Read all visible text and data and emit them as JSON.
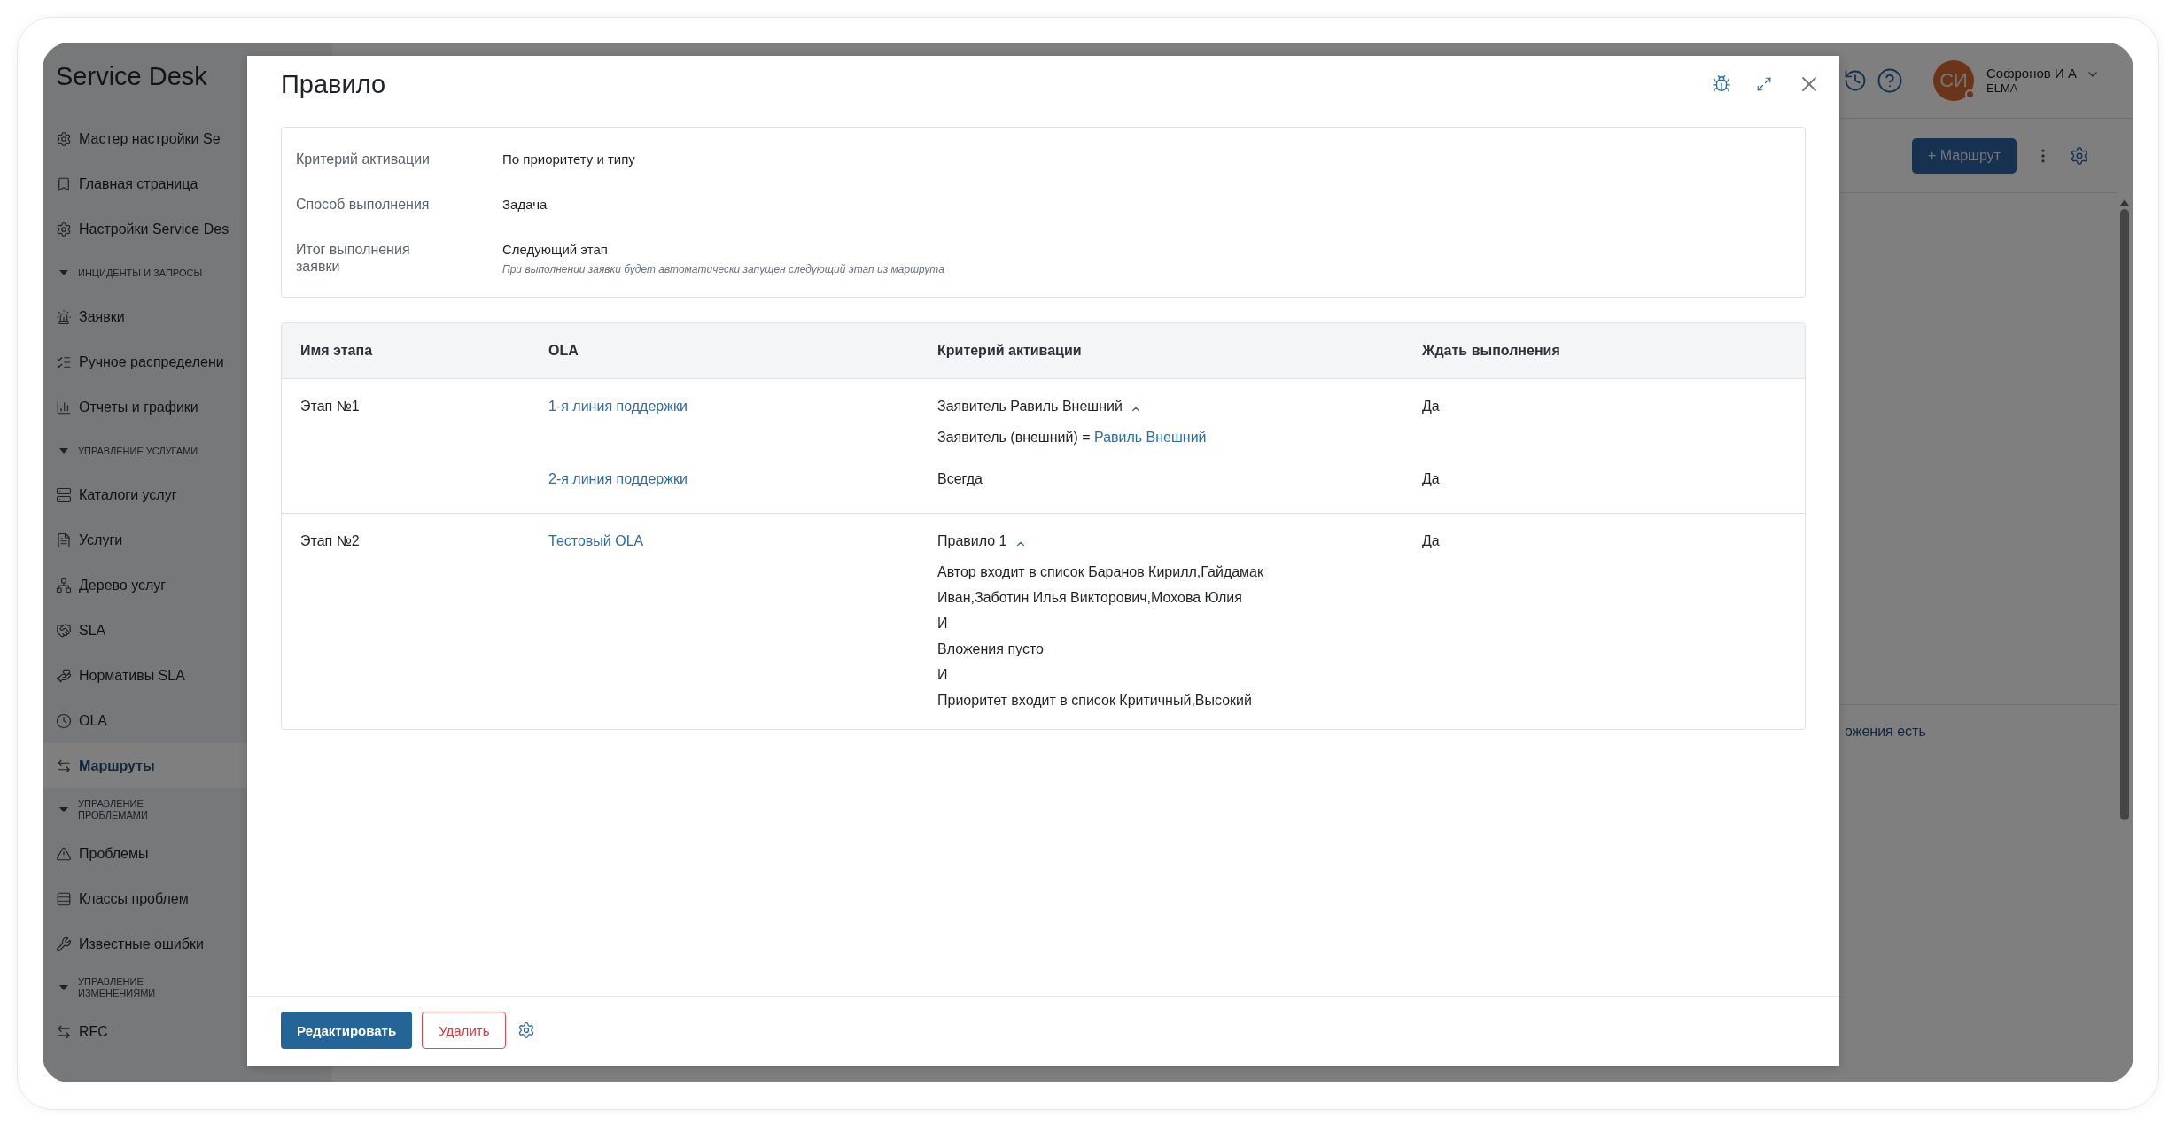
{
  "app": {
    "title": "Service Desk"
  },
  "sidebar": {
    "items": [
      {
        "kind": "item",
        "label": "Мастер настройки Se",
        "selected": false
      },
      {
        "kind": "item",
        "label": "Главная страница",
        "selected": false
      },
      {
        "kind": "item",
        "label": "Настройки Service Des",
        "selected": false
      },
      {
        "kind": "section",
        "label": "ИНЦИДЕНТЫ И ЗАПРОСЫ",
        "expanded": true
      },
      {
        "kind": "item",
        "label": "Заявки",
        "selected": false
      },
      {
        "kind": "item",
        "label": "Ручное распределени",
        "selected": false
      },
      {
        "kind": "item",
        "label": "Отчеты и графики",
        "selected": false
      },
      {
        "kind": "section",
        "label": "УПРАВЛЕНИЕ УСЛУГАМИ",
        "expanded": true
      },
      {
        "kind": "item",
        "label": "Каталоги услуг",
        "selected": false
      },
      {
        "kind": "item",
        "label": "Услуги",
        "selected": false
      },
      {
        "kind": "item",
        "label": "Дерево услуг",
        "selected": false
      },
      {
        "kind": "item",
        "label": "SLA",
        "selected": false
      },
      {
        "kind": "item",
        "label": "Нормативы SLA",
        "selected": false
      },
      {
        "kind": "item",
        "label": "OLA",
        "selected": false
      },
      {
        "kind": "item",
        "label": "Маршруты",
        "selected": true
      },
      {
        "kind": "section",
        "label": "УПРАВЛЕНИЕ\nПРОБЛЕМАМИ",
        "expanded": true
      },
      {
        "kind": "item",
        "label": "Проблемы",
        "selected": false
      },
      {
        "kind": "item",
        "label": "Классы проблем",
        "selected": false
      },
      {
        "kind": "item",
        "label": "Известные ошибки",
        "selected": false
      },
      {
        "kind": "section",
        "label": "УПРАВЛЕНИЕ\nИЗМЕНЕНИЯМИ",
        "expanded": true
      },
      {
        "kind": "item",
        "label": "RFC",
        "selected": false
      }
    ]
  },
  "header": {
    "user": {
      "initials": "СИ",
      "name": "Софронов И А",
      "company": "ELMA"
    }
  },
  "toolbar": {
    "add_button": "+ Маршрут"
  },
  "list": {
    "row_text": "ожения есть"
  },
  "modal": {
    "title": "Правило",
    "info": [
      {
        "label": "Критерий активации",
        "value": "По приоритету и типу"
      },
      {
        "label": "Способ выполнения",
        "value": "Задача"
      },
      {
        "label": "Итог выполнения заявки",
        "value": "Следующий этап",
        "hint": "При выполнении заявки будет автоматически запущен следующий этап из маршрута"
      }
    ],
    "table": {
      "columns": [
        "Имя этапа",
        "OLA",
        "Критерий активации",
        "Ждать выполнения"
      ],
      "rows": [
        {
          "stage": "Этап №1",
          "entries": [
            {
              "ola": "1-я линия поддержки",
              "criterion": {
                "title": "Заявитель Равиль Внешний",
                "expanded": true,
                "details": [
                  {
                    "text": "Заявитель (внешний) =",
                    "link": "Равиль Внешний"
                  }
                ]
              },
              "wait": "Да"
            },
            {
              "ola": "2-я линия поддержки",
              "criterion": {
                "title": "Всегда"
              },
              "wait": "Да"
            }
          ]
        },
        {
          "stage": "Этап №2",
          "entries": [
            {
              "ola": "Тестовый OLA",
              "criterion": {
                "title": "Правило 1",
                "expanded": true,
                "details": [
                  {
                    "text": "Автор входит в список Баранов Кирилл,Гайдамак Иван,Заботин Илья Викторович,Мохова Юлия"
                  },
                  {
                    "text": "И"
                  },
                  {
                    "text": "Вложения пусто"
                  },
                  {
                    "text": "И"
                  },
                  {
                    "text": "Приоритет входит в список Критичный,Высокий"
                  }
                ]
              },
              "wait": "Да"
            }
          ]
        }
      ]
    },
    "buttons": {
      "edit": "Редактировать",
      "delete": "Удалить"
    }
  }
}
